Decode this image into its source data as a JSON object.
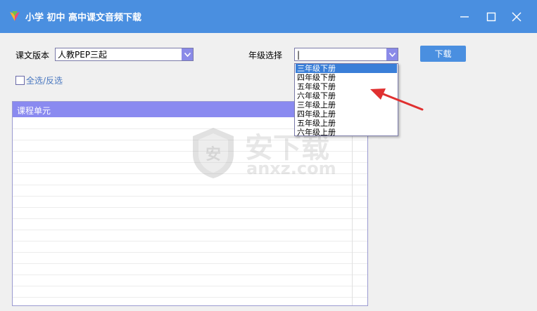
{
  "window": {
    "title": "小学 初中 高中课文音频下载",
    "minimize_icon": "minimize-icon",
    "maximize_icon": "maximize-icon",
    "close_icon": "close-icon"
  },
  "form": {
    "edition_label": "课文版本",
    "edition_value": "人教PEP三起",
    "grade_label": "年级选择",
    "grade_value": "|",
    "download_label": "下载",
    "select_all_label": "全选/反选"
  },
  "list": {
    "header": "课程单元"
  },
  "grade_dropdown": {
    "options": [
      "三年级下册",
      "四年级下册",
      "五年级下册",
      "六年级下册",
      "三年级上册",
      "四年级上册",
      "五年级上册",
      "六年级上册"
    ],
    "selected_index": 0
  },
  "watermark": {
    "text_cn": "安下载",
    "text_en": "anxz.com",
    "badge": "安"
  },
  "colors": {
    "titlebar": "#4a8fe0",
    "accent": "#8a8af0",
    "selection": "#3a7fd8",
    "annotation_arrow": "#e03030"
  }
}
